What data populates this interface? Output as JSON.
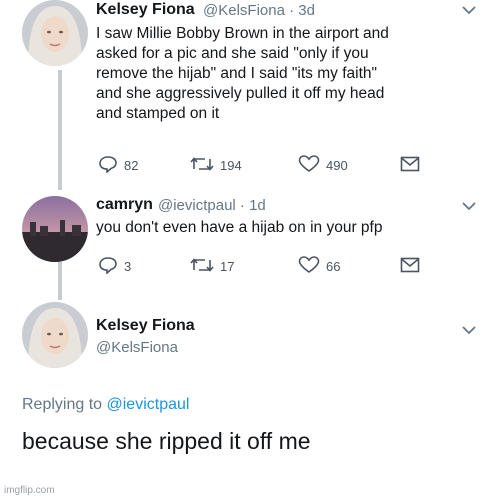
{
  "tweet1": {
    "name": "Kelsey Fiona",
    "meta": "@KelsFiona · 3d",
    "text": [
      "I saw Millie Bobby Brown in the airport and",
      "asked for a pic and she said \"only if you",
      "remove the hijab\" and I said \"its my faith\"",
      "and she aggressively pulled it off my head",
      "and stamped on it"
    ],
    "replies": "82",
    "retweets": "194",
    "likes": "490"
  },
  "tweet2": {
    "name": "camryn",
    "meta": "@ievictpaul · 1d",
    "text": "you don't even have a hijab on in your pfp",
    "replies": "3",
    "retweets": "17",
    "likes": "66"
  },
  "tweet3": {
    "name": "Kelsey Fiona",
    "handle": "@KelsFiona",
    "replying_prefix": "Replying to",
    "replying_user": "@ievictpaul",
    "text": "because she ripped it off me"
  },
  "icons": {
    "reply": "reply-icon",
    "retweet": "retweet-icon",
    "like": "heart-icon",
    "dm": "envelope-icon",
    "more": "chevron-down-icon"
  },
  "watermark": "imgflip.com",
  "colors": {
    "link": "#1b95e0",
    "muted": "#657786",
    "text": "#14171a"
  }
}
